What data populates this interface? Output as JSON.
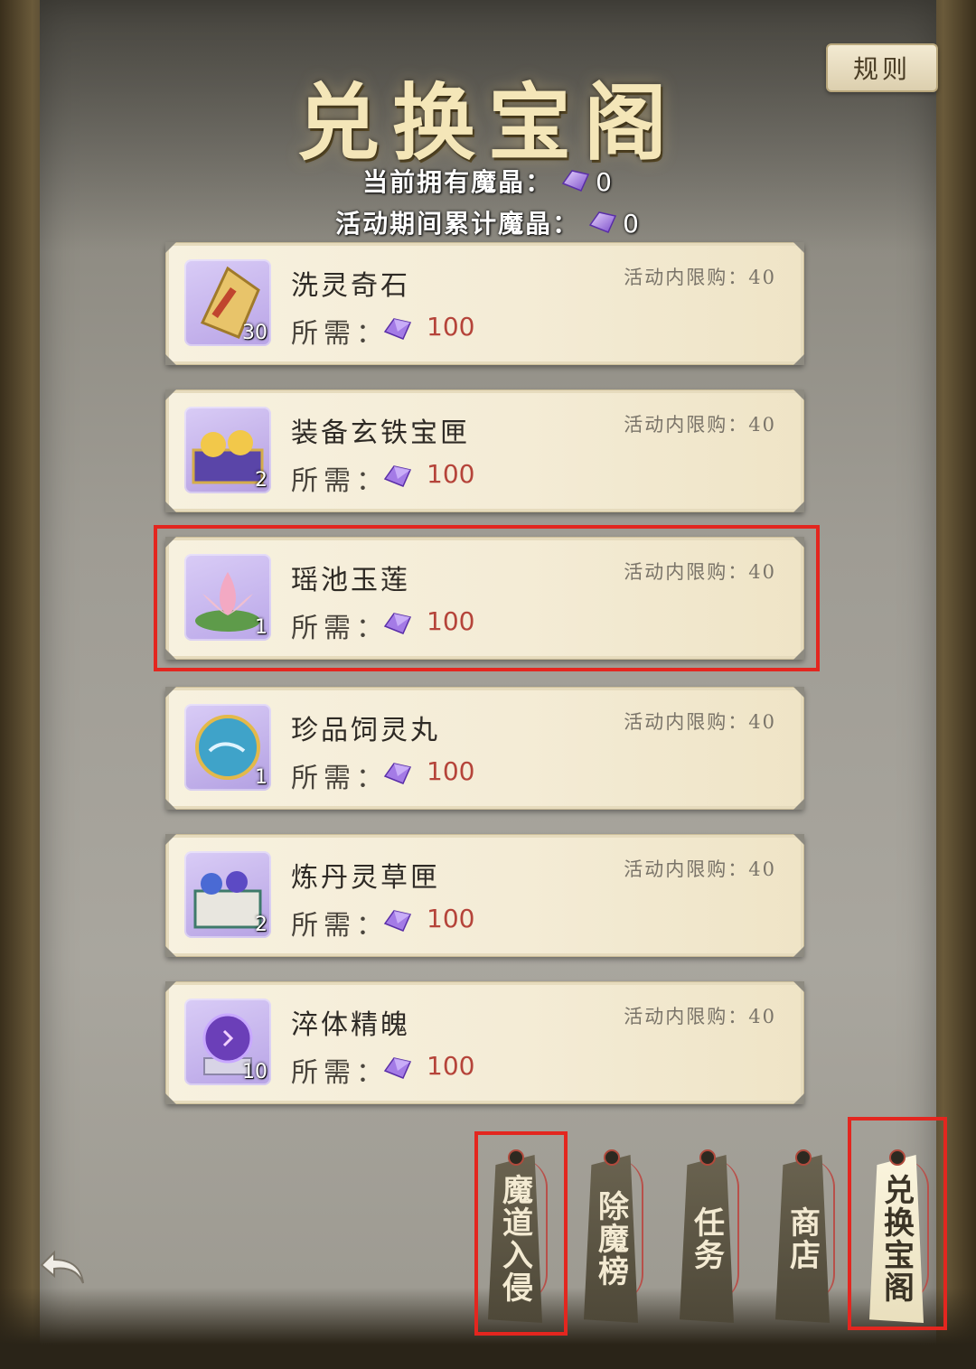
{
  "header": {
    "title": "兑换宝阁",
    "rules_label": "规则"
  },
  "balance": {
    "current_label": "当前拥有魔晶：",
    "current_value": "0",
    "total_label": "活动期间累计魔晶：",
    "total_value": "0"
  },
  "items": [
    {
      "name": "洗灵奇石",
      "qty": "30",
      "limit_label": "活动内限购：40",
      "cost_label": "所需：",
      "cost": "100",
      "icon": "spirit-stone-icon",
      "bg": "#b9a4e6"
    },
    {
      "name": "装备玄铁宝匣",
      "qty": "2",
      "limit_label": "活动内限购：40",
      "cost_label": "所需：",
      "cost": "100",
      "icon": "treasure-chest-icon",
      "bg": "#b49ee0"
    },
    {
      "name": "瑶池玉莲",
      "qty": "1",
      "limit_label": "活动内限购：40",
      "cost_label": "所需：",
      "cost": "100",
      "icon": "lotus-icon",
      "bg": "#baa7e8"
    },
    {
      "name": "珍品饲灵丸",
      "qty": "1",
      "limit_label": "活动内限购：40",
      "cost_label": "所需：",
      "cost": "100",
      "icon": "orb-pill-icon",
      "bg": "#b3a0e2"
    },
    {
      "name": "炼丹灵草匣",
      "qty": "2",
      "limit_label": "活动内限购：40",
      "cost_label": "所需：",
      "cost": "100",
      "icon": "herb-box-icon",
      "bg": "#b6a2e3"
    },
    {
      "name": "淬体精魄",
      "qty": "10",
      "limit_label": "活动内限购：40",
      "cost_label": "所需：",
      "cost": "100",
      "icon": "purple-crystal-ball-icon",
      "bg": "#b8a4e6"
    }
  ],
  "tabs": [
    {
      "label": "魔道入侵",
      "active": false
    },
    {
      "label": "除魔榜",
      "active": false
    },
    {
      "label": "任务",
      "active": false
    },
    {
      "label": "商店",
      "active": false
    },
    {
      "label": "兑换宝阁",
      "active": true
    }
  ],
  "colors": {
    "highlight": "#e3261f",
    "cost_red": "#b5443a",
    "gem_purple": "#8a5fd6"
  }
}
